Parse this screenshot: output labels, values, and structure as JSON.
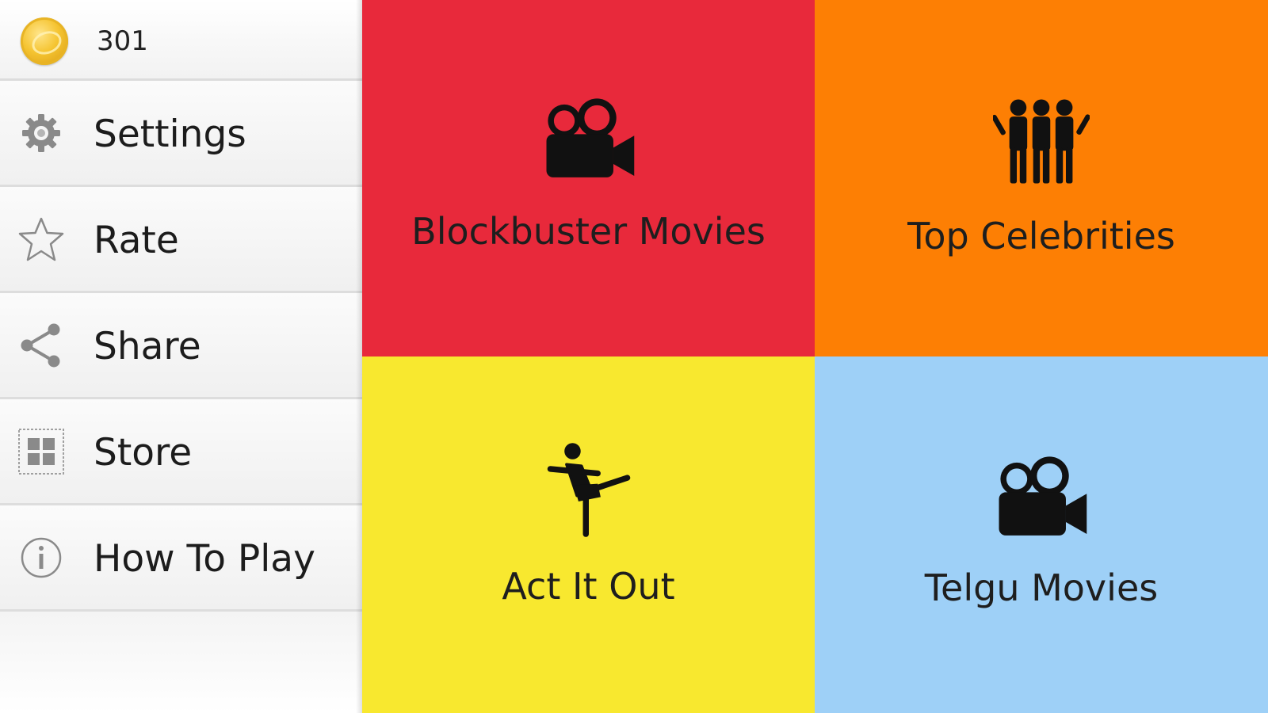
{
  "sidebar": {
    "coin_count": "301",
    "items": [
      {
        "label": "Settings",
        "icon": "gear-icon"
      },
      {
        "label": "Rate",
        "icon": "star-icon"
      },
      {
        "label": "Share",
        "icon": "share-icon"
      },
      {
        "label": "Store",
        "icon": "grid-icon"
      },
      {
        "label": "How To Play",
        "icon": "info-icon"
      }
    ]
  },
  "tiles": [
    {
      "label": "Blockbuster Movies",
      "icon": "movie-camera-icon",
      "color": "#e8293b"
    },
    {
      "label": "Top Celebrities",
      "icon": "group-people-icon",
      "color": "#fd7f04"
    },
    {
      "label": "Act It Out",
      "icon": "kicking-person-icon",
      "color": "#f8e82f"
    },
    {
      "label": "Telgu Movies",
      "icon": "movie-camera-icon",
      "color": "#9ed0f7"
    }
  ]
}
